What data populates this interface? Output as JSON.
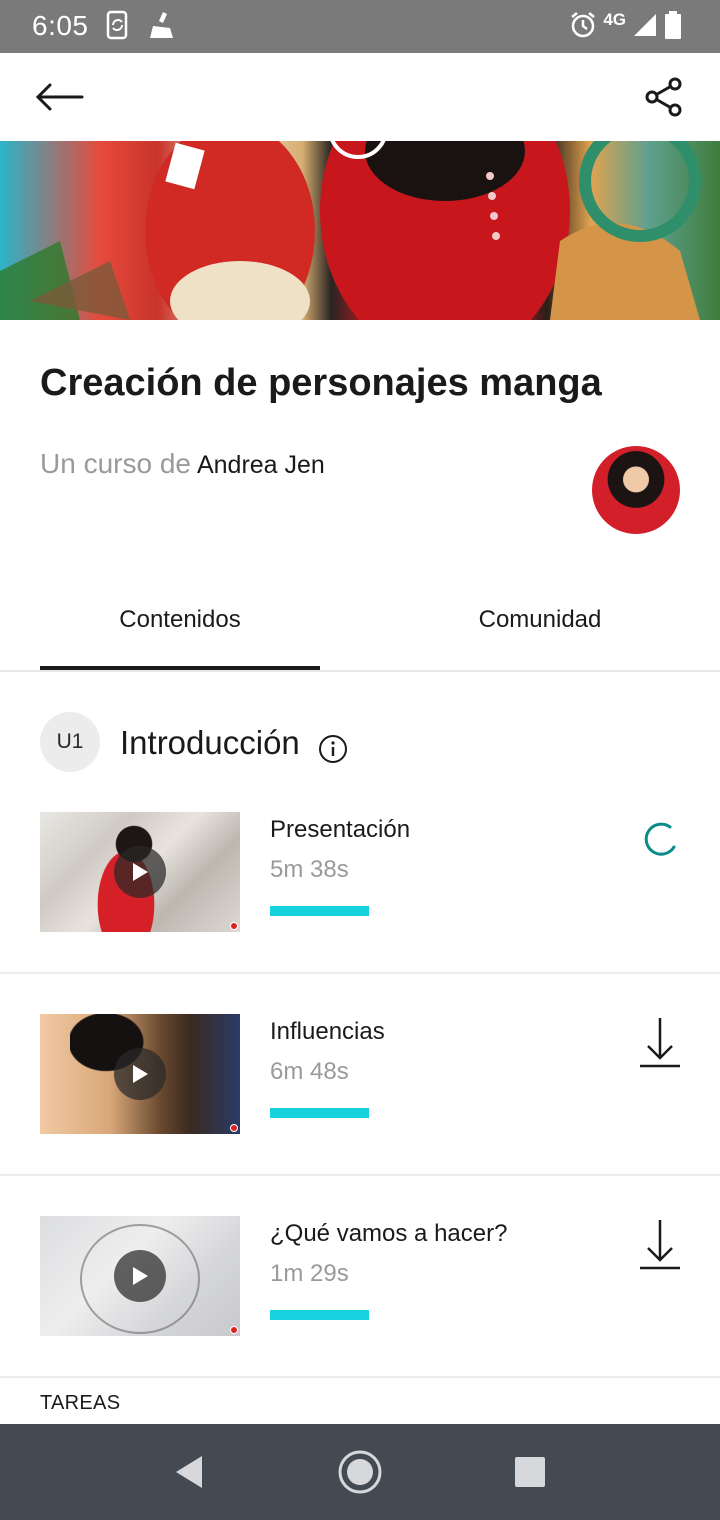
{
  "status_bar": {
    "time": "6:05",
    "network": "4G",
    "icons": [
      "sync-phone-icon",
      "cleaner-icon",
      "alarm-icon",
      "signal-icon",
      "battery-icon"
    ]
  },
  "app_bar": {
    "back_icon": "arrow-left-icon",
    "share_icon": "share-icon"
  },
  "course": {
    "title": "Creación de personajes manga",
    "author_prefix": "Un curso de",
    "author_name": "Andrea Jen"
  },
  "tabs": [
    {
      "label": "Contenidos",
      "selected": true
    },
    {
      "label": "Comunidad",
      "selected": false
    }
  ],
  "unit": {
    "badge": "U1",
    "title": "Introducción",
    "info_icon": "info-icon"
  },
  "lessons": [
    {
      "title": "Presentación",
      "duration": "5m 38s",
      "progress_percent": 100,
      "action_icon": "loading-spinner-icon"
    },
    {
      "title": "Influencias",
      "duration": "6m 48s",
      "progress_percent": 100,
      "action_icon": "download-icon"
    },
    {
      "title": "¿Qué vamos a hacer?",
      "duration": "1m 29s",
      "progress_percent": 100,
      "action_icon": "download-icon"
    }
  ],
  "tareas_label": "TAREAS",
  "colors": {
    "accent_progress": "#16d1de",
    "spinner": "#0a8a8a",
    "status_bar": "#7a7a7a",
    "nav_bar": "#444a52"
  }
}
